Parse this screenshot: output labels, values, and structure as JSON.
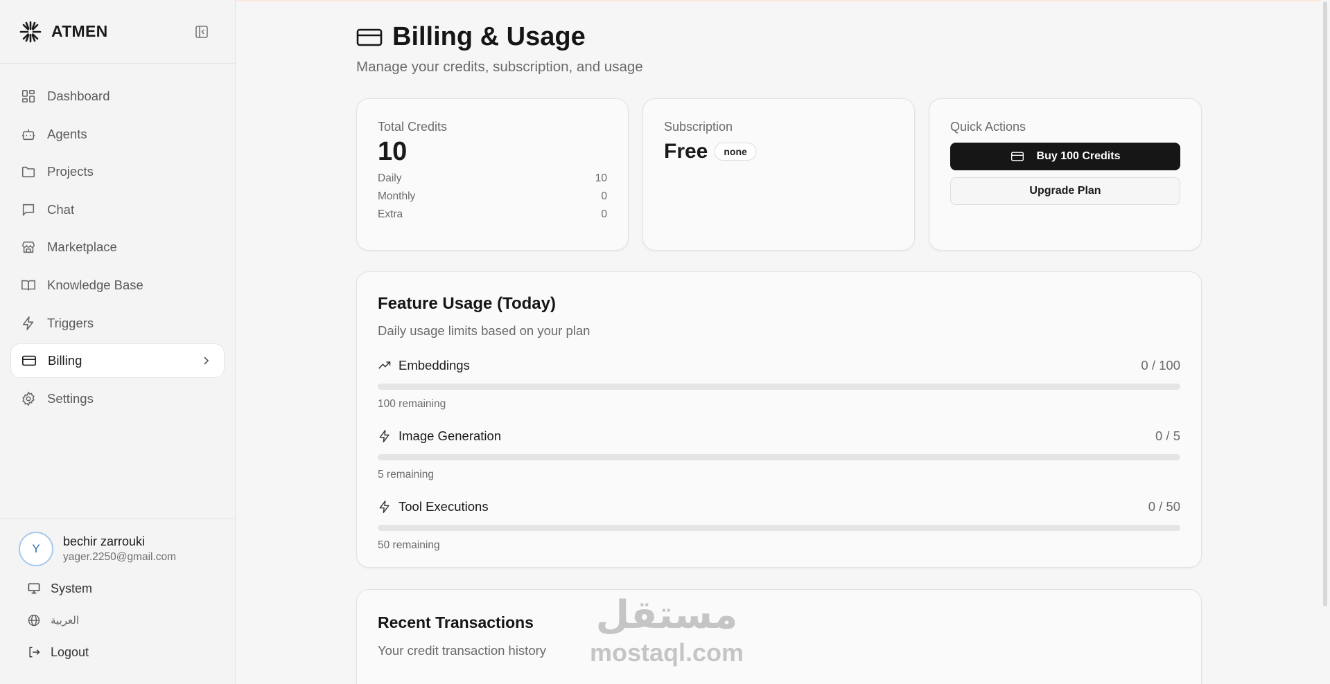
{
  "brand": {
    "name": "ATMEN"
  },
  "nav": {
    "items": [
      {
        "label": "Dashboard",
        "icon": "dashboard-icon"
      },
      {
        "label": "Agents",
        "icon": "bot-icon"
      },
      {
        "label": "Projects",
        "icon": "folder-icon"
      },
      {
        "label": "Chat",
        "icon": "chat-icon"
      },
      {
        "label": "Marketplace",
        "icon": "store-icon"
      },
      {
        "label": "Knowledge Base",
        "icon": "book-icon"
      },
      {
        "label": "Triggers",
        "icon": "bolt-icon"
      },
      {
        "label": "Billing",
        "icon": "credit-card-icon",
        "active": true
      },
      {
        "label": "Settings",
        "icon": "gear-icon"
      }
    ]
  },
  "user": {
    "initial": "Y",
    "name": "bechir zarrouki",
    "email": "yager.2250@gmail.com"
  },
  "utils": {
    "theme_label": "System",
    "language_label": "العربية",
    "logout_label": "Logout"
  },
  "page": {
    "title": "Billing & Usage",
    "subtitle": "Manage your credits, subscription, and usage"
  },
  "credits": {
    "label": "Total Credits",
    "total": "10",
    "rows": [
      {
        "label": "Daily",
        "value": "10"
      },
      {
        "label": "Monthly",
        "value": "0"
      },
      {
        "label": "Extra",
        "value": "0"
      }
    ]
  },
  "subscription": {
    "label": "Subscription",
    "plan": "Free",
    "status": "none"
  },
  "quick_actions": {
    "label": "Quick Actions",
    "buy_label": "Buy 100 Credits",
    "upgrade_label": "Upgrade Plan"
  },
  "feature_usage": {
    "title": "Feature Usage (Today)",
    "subtitle": "Daily usage limits based on your plan",
    "items": [
      {
        "name": "Embeddings",
        "value": "0 / 100",
        "used": 0,
        "limit": 100,
        "remaining": "100 remaining",
        "icon": "trending-up-icon"
      },
      {
        "name": "Image Generation",
        "value": "0 / 5",
        "used": 0,
        "limit": 5,
        "remaining": "5 remaining",
        "icon": "bolt-icon"
      },
      {
        "name": "Tool Executions",
        "value": "0 / 50",
        "used": 0,
        "limit": 50,
        "remaining": "50 remaining",
        "icon": "bolt-icon"
      }
    ]
  },
  "transactions": {
    "title": "Recent Transactions",
    "subtitle": "Your credit transaction history"
  },
  "watermark": {
    "arabic": "مستقل",
    "latin": "mostaql.com"
  },
  "colors": {
    "accent": "#161616",
    "avatar_ring": "#a7c8ee",
    "avatar_text": "#2b6cb0"
  }
}
